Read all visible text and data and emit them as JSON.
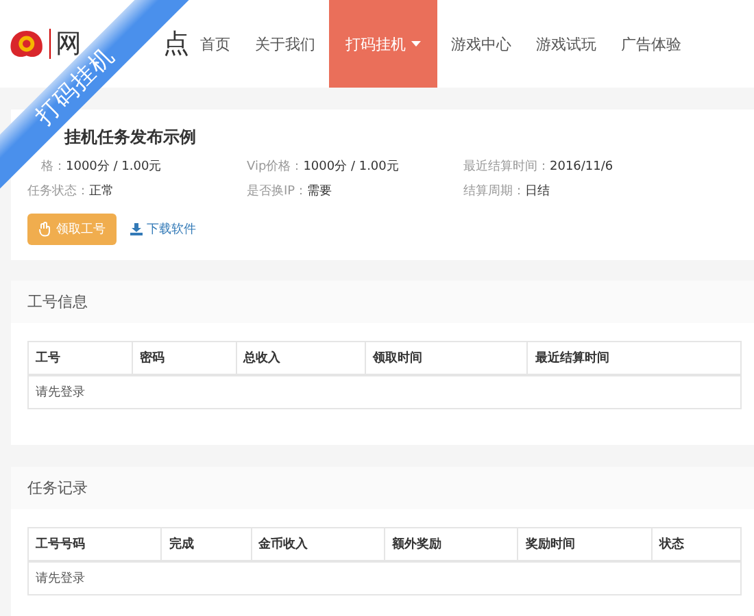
{
  "ribbon": {
    "text": "打码挂机"
  },
  "logo": {
    "text_start": "网",
    "text_end": "点"
  },
  "nav": [
    {
      "label": "首页",
      "selected": false,
      "dropdown": false
    },
    {
      "label": "关于我们",
      "selected": false,
      "dropdown": false
    },
    {
      "label": "打码挂机",
      "selected": true,
      "dropdown": true
    },
    {
      "label": "游戏中心",
      "selected": false,
      "dropdown": false
    },
    {
      "label": "游戏试玩",
      "selected": false,
      "dropdown": false
    },
    {
      "label": "广告体验",
      "selected": false,
      "dropdown": false
    }
  ],
  "task": {
    "title": "挂机任务发布示例",
    "fields": [
      {
        "label": "格：",
        "value": "1000分 / 1.00元"
      },
      {
        "label": "Vip价格：",
        "value": "1000分 / 1.00元"
      },
      {
        "label": "最近结算时间：",
        "value": "2016/11/6"
      },
      {
        "label": "任务状态：",
        "value": "正常"
      },
      {
        "label": "是否换IP：",
        "value": "需要"
      },
      {
        "label": "结算周期：",
        "value": "日结"
      }
    ],
    "claim_button": "领取工号",
    "download_link": "下载软件"
  },
  "sections": [
    {
      "title": "工号信息",
      "columns": [
        "工号",
        "密码",
        "总收入",
        "领取时间",
        "最近结算时间"
      ],
      "empty": "请先登录"
    },
    {
      "title": "任务记录",
      "columns": [
        "工号号码",
        "完成",
        "金币收入",
        "额外奖励",
        "奖励时间",
        "状态"
      ],
      "empty": "请先登录"
    }
  ]
}
